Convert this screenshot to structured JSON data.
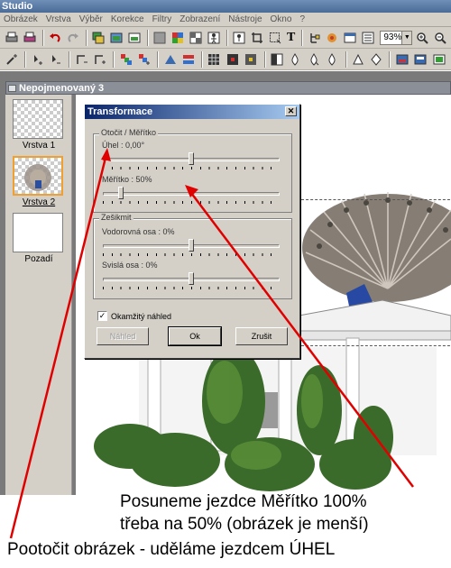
{
  "app": {
    "title": "Studio"
  },
  "menu": [
    "Obrázek",
    "Vrstva",
    "Výběr",
    "Korekce",
    "Filtry",
    "Zobrazení",
    "Nástroje",
    "Okno",
    "?"
  ],
  "toolbar": {
    "zoom": "93%",
    "text_tool_glyph": "T"
  },
  "document": {
    "title": "Nepojmenovaný 3"
  },
  "layers": [
    {
      "label": "Vrstva 1",
      "selected": false
    },
    {
      "label": "Vrstva 2",
      "selected": true
    },
    {
      "label": "Pozadí",
      "selected": false
    }
  ],
  "dialog": {
    "title": "Transformace",
    "rotate_group": "Otočit / Měřítko",
    "angle_label": "Úhel : 0,00°",
    "angle_value": 0.5,
    "scale_label": "Měřítko : 50%",
    "scale_value": 0.1,
    "skew_group": "Zešikmit",
    "horizontal_label": "Vodorovná osa : 0%",
    "horizontal_value": 0.5,
    "vertical_label": "Svislá osa : 0%",
    "vertical_value": 0.5,
    "preview_label": "Okamžitý náhled",
    "preview_checked": true,
    "preview_button": "Náhled",
    "ok_button": "Ok",
    "cancel_button": "Zrušit"
  },
  "annotations": {
    "line1": "Posuneme jezdce Měřítko 100%",
    "line2": "třeba na 50% (obrázek je menší)",
    "line3": "Pootočit obrázek -  uděláme jezdcem ÚHEL",
    "arrow_color": "#e00000"
  }
}
